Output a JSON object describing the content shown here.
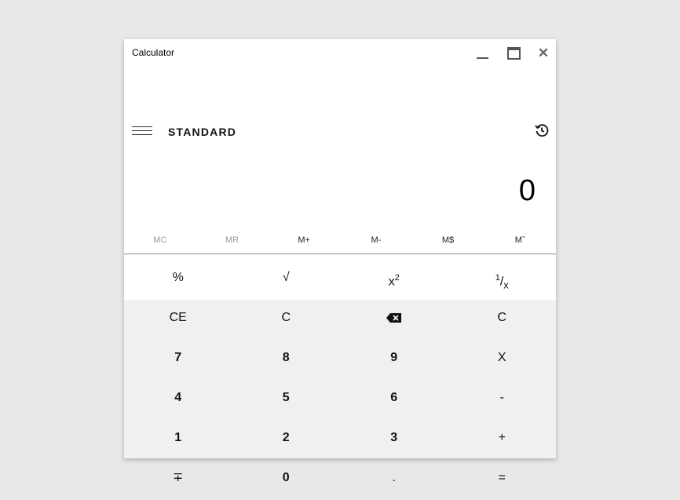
{
  "window": {
    "title": "Calculator"
  },
  "header": {
    "mode": "STANDARD"
  },
  "display": {
    "value": "0"
  },
  "memory": [
    "MC",
    "MR",
    "M+",
    "M-",
    "M$",
    "Mˇ"
  ],
  "functions": {
    "percent": "%",
    "sqrt": "√",
    "square_base": "x",
    "square_exp": "2",
    "recip_num": "1",
    "recip_den": "x"
  },
  "keys": {
    "ce": "CE",
    "c": "C",
    "c2": "C",
    "seven": "7",
    "eight": "8",
    "nine": "9",
    "multiply": "X",
    "four": "4",
    "five": "5",
    "six": "6",
    "minus": "-",
    "one": "1",
    "two": "2",
    "three": "3",
    "plus": "+",
    "negate": "∓",
    "zero": "0",
    "decimal": ".",
    "equals": "="
  },
  "icons": {
    "menu": "hamburger-icon",
    "history": "history-icon",
    "backspace": "backspace-icon",
    "minimize": "minimize-icon",
    "maximize": "maximize-icon",
    "close": "close-icon"
  },
  "colors": {
    "background": "#e8e8e8",
    "top_panel": "#ffffff",
    "keypad": "#f0f0f0",
    "disabled_text": "#9a9a9a"
  }
}
